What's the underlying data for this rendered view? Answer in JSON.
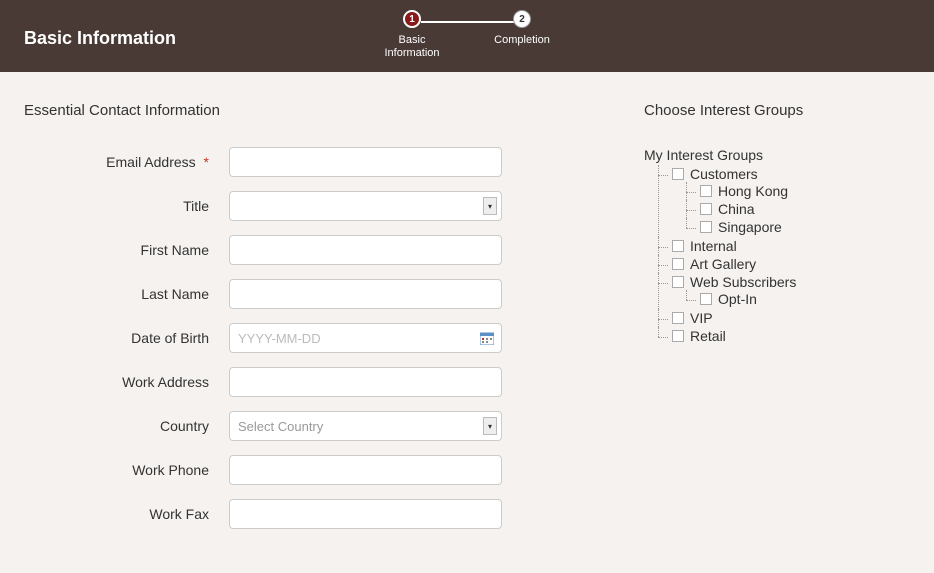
{
  "header": {
    "title": "Basic Information",
    "steps": [
      {
        "num": "1",
        "label": "Basic\nInformation",
        "active": true
      },
      {
        "num": "2",
        "label": "Completion",
        "active": false
      }
    ]
  },
  "form": {
    "heading": "Essential Contact Information",
    "fields": {
      "email": {
        "label": "Email Address",
        "required": true,
        "value": ""
      },
      "title": {
        "label": "Title",
        "value": ""
      },
      "first_name": {
        "label": "First Name",
        "value": ""
      },
      "last_name": {
        "label": "Last Name",
        "value": ""
      },
      "dob": {
        "label": "Date of Birth",
        "placeholder": "YYYY-MM-DD",
        "value": ""
      },
      "work_address": {
        "label": "Work Address",
        "value": ""
      },
      "country": {
        "label": "Country",
        "placeholder": "Select Country",
        "value": ""
      },
      "work_phone": {
        "label": "Work Phone",
        "value": ""
      },
      "work_fax": {
        "label": "Work Fax",
        "value": ""
      }
    }
  },
  "interest_groups": {
    "heading": "Choose Interest Groups",
    "root_label": "My Interest Groups",
    "tree": [
      {
        "label": "Customers",
        "children": [
          {
            "label": "Hong Kong"
          },
          {
            "label": "China"
          },
          {
            "label": "Singapore"
          }
        ]
      },
      {
        "label": "Internal"
      },
      {
        "label": "Art Gallery"
      },
      {
        "label": "Web Subscribers",
        "children": [
          {
            "label": "Opt-In"
          }
        ]
      },
      {
        "label": "VIP"
      },
      {
        "label": "Retail"
      }
    ]
  }
}
